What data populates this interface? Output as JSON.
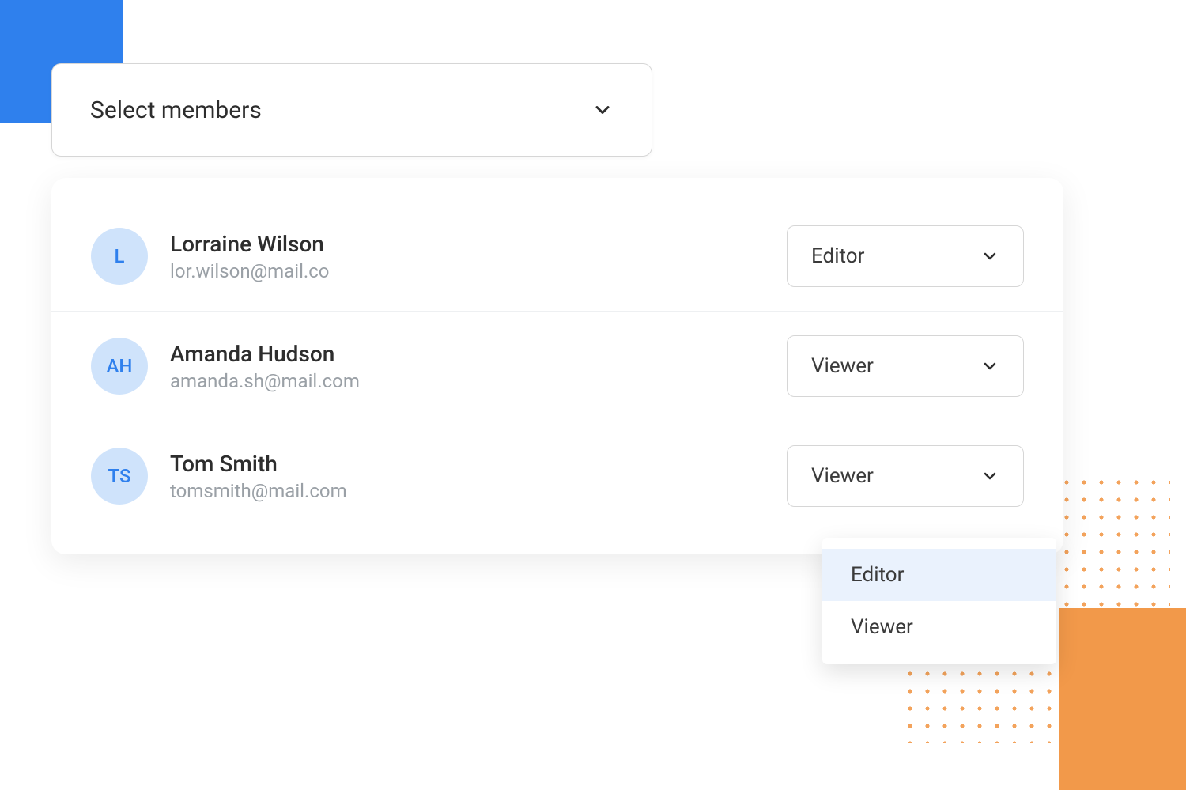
{
  "decor": {
    "blue_color": "#2f80ed",
    "orange_color": "#f2a900"
  },
  "select_dropdown": {
    "label": "Select members"
  },
  "members": [
    {
      "initials": "L",
      "name": "Lorraine Wilson",
      "email": "lor.wilson@mail.co",
      "role": "Editor"
    },
    {
      "initials": "AH",
      "name": "Amanda Hudson",
      "email": "amanda.sh@mail.com",
      "role": "Viewer"
    },
    {
      "initials": "TS",
      "name": "Tom Smith",
      "email": "tomsmith@mail.com",
      "role": "Viewer"
    }
  ],
  "role_options": {
    "option_0": "Editor",
    "option_1": "Viewer"
  }
}
